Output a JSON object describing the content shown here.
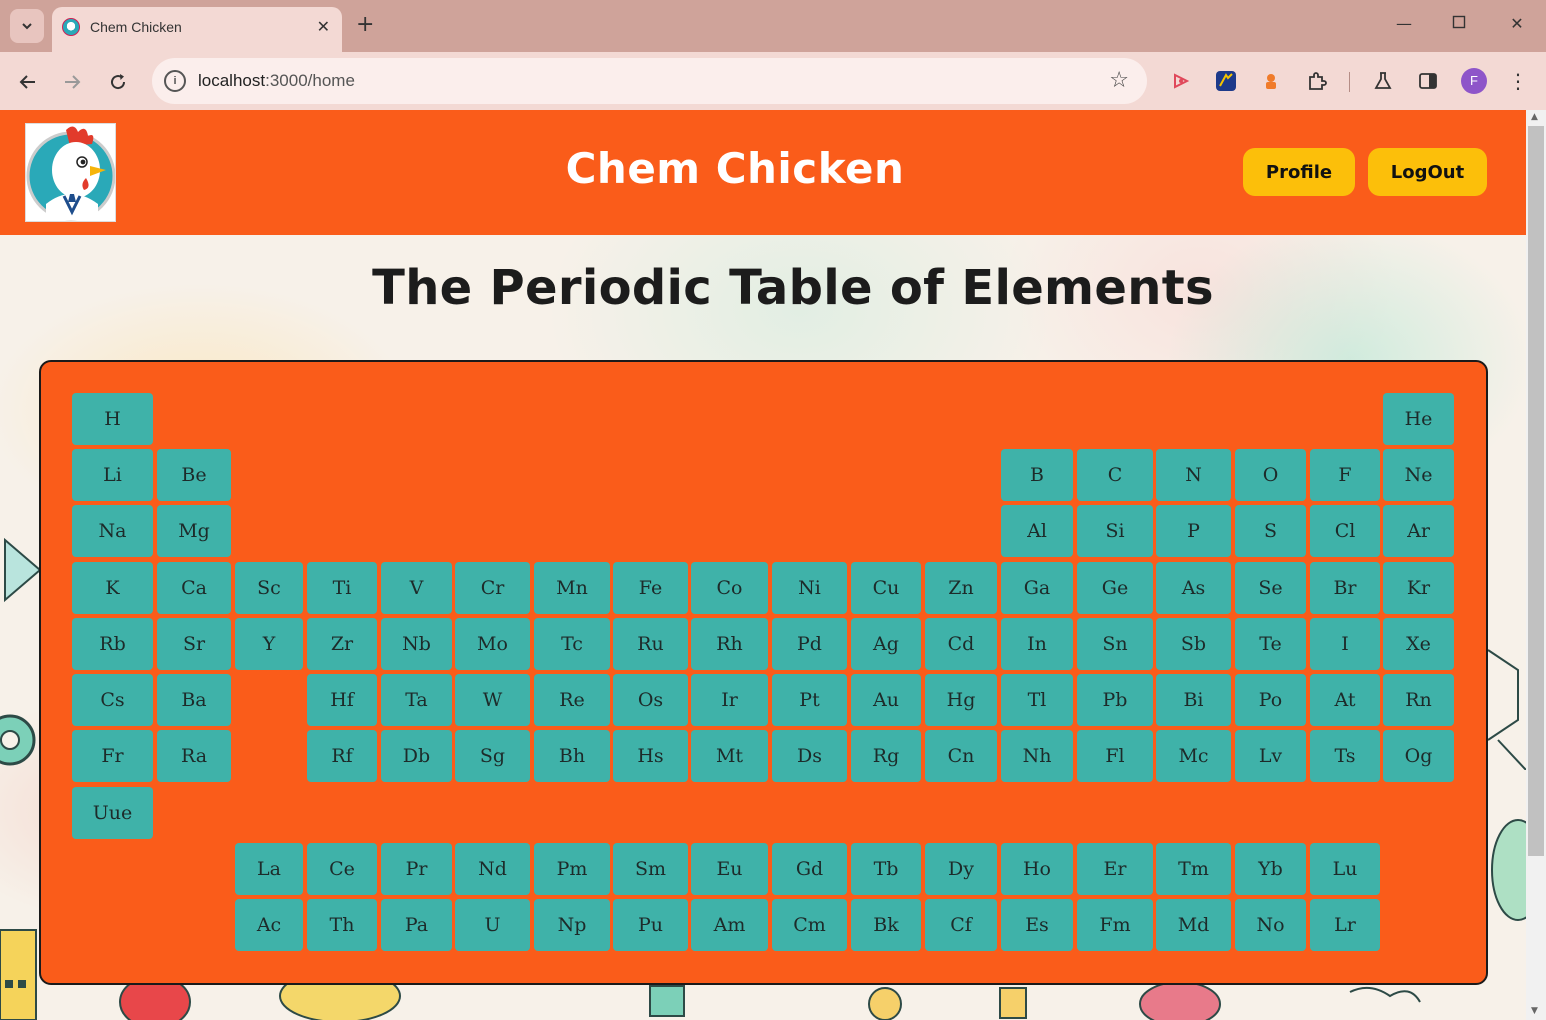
{
  "browser": {
    "tab_title": "Chem Chicken",
    "url_host": "localhost",
    "url_path": ":3000/home",
    "profile_initial": "F"
  },
  "header": {
    "title": "Chem Chicken",
    "profile_label": "Profile",
    "logout_label": "LogOut"
  },
  "page": {
    "title": "The Periodic Table of Elements"
  },
  "periodic_table": {
    "rows": [
      [
        "H",
        "He"
      ],
      [
        "Li",
        "Be",
        "B",
        "C",
        "N",
        "O",
        "F",
        "Ne"
      ],
      [
        "Na",
        "Mg",
        "Al",
        "Si",
        "P",
        "S",
        "Cl",
        "Ar"
      ],
      [
        "K",
        "Ca",
        "Sc",
        "Ti",
        "V",
        "Cr",
        "Mn",
        "Fe",
        "Co",
        "Ni",
        "Cu",
        "Zn",
        "Ga",
        "Ge",
        "As",
        "Se",
        "Br",
        "Kr"
      ],
      [
        "Rb",
        "Sr",
        "Y",
        "Zr",
        "Nb",
        "Mo",
        "Tc",
        "Ru",
        "Rh",
        "Pd",
        "Ag",
        "Cd",
        "In",
        "Sn",
        "Sb",
        "Te",
        "I",
        "Xe"
      ],
      [
        "Cs",
        "Ba",
        "Hf",
        "Ta",
        "W",
        "Re",
        "Os",
        "Ir",
        "Pt",
        "Au",
        "Hg",
        "Tl",
        "Pb",
        "Bi",
        "Po",
        "At",
        "Rn"
      ],
      [
        "Fr",
        "Ra",
        "Rf",
        "Db",
        "Sg",
        "Bh",
        "Hs",
        "Mt",
        "Ds",
        "Rg",
        "Cn",
        "Nh",
        "Fl",
        "Mc",
        "Lv",
        "Ts",
        "Og"
      ],
      [
        "Uue"
      ],
      [
        "La",
        "Ce",
        "Pr",
        "Nd",
        "Pm",
        "Sm",
        "Eu",
        "Gd",
        "Tb",
        "Dy",
        "Ho",
        "Er",
        "Tm",
        "Yb",
        "Lu"
      ],
      [
        "Ac",
        "Th",
        "Pa",
        "U",
        "Np",
        "Pu",
        "Am",
        "Cm",
        "Bk",
        "Cf",
        "Es",
        "Fm",
        "Md",
        "No",
        "Lr"
      ]
    ]
  },
  "colors": {
    "header_bg": "#fa5c1a",
    "button_bg": "#fcbf0a",
    "element_tile": "#3fb2a9",
    "table_bg": "#fa5c1a"
  }
}
